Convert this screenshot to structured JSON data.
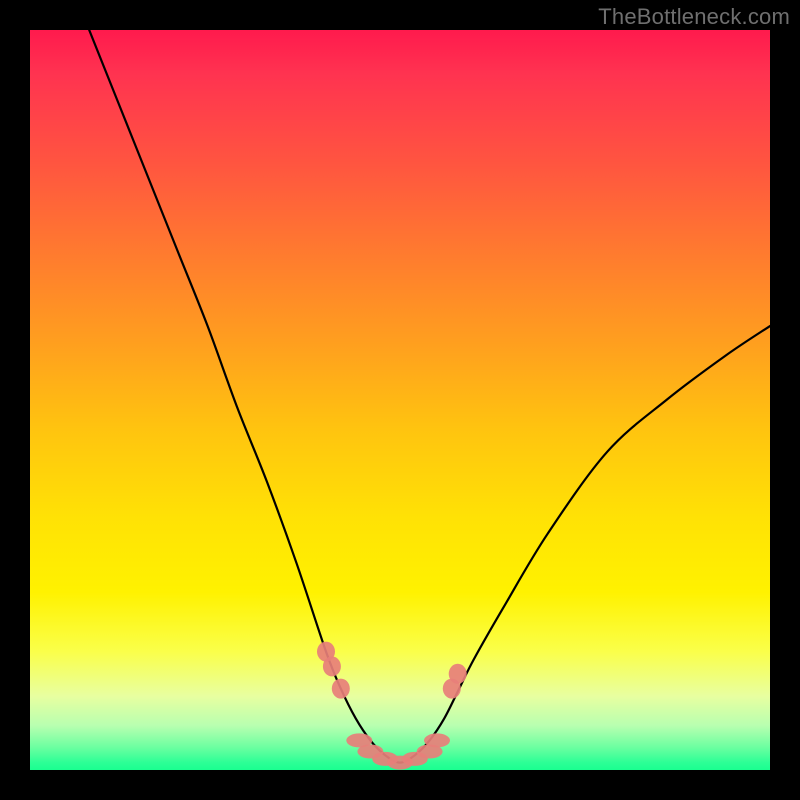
{
  "watermark": "TheBottleneck.com",
  "chart_data": {
    "type": "line",
    "title": "",
    "xlabel": "",
    "ylabel": "",
    "xlim": [
      0,
      100
    ],
    "ylim": [
      0,
      100
    ],
    "legend": false,
    "grid": false,
    "notes": "V-shaped bottleneck curve on a red→yellow→green vertical heat gradient. Single black curve dips from ~100% at x≈8 down to ~0% around x≈45–55, then rises to ~60% at x≈100. Salmon-pink highlight markers cluster near the valley floor and just above it on both flanks.",
    "series": [
      {
        "name": "bottleneck-curve",
        "color": "#000000",
        "x": [
          8,
          12,
          16,
          20,
          24,
          28,
          32,
          36,
          40,
          42,
          44,
          46,
          48,
          50,
          52,
          54,
          56,
          58,
          60,
          64,
          70,
          78,
          86,
          94,
          100
        ],
        "values": [
          100,
          90,
          80,
          70,
          60,
          49,
          39,
          28,
          16,
          11,
          7,
          4,
          2,
          1,
          2,
          4,
          7,
          11,
          15,
          22,
          32,
          43,
          50,
          56,
          60
        ]
      }
    ],
    "highlight_points": {
      "name": "valley-markers",
      "color": "#e77f7a",
      "points": [
        {
          "x": 40.0,
          "y": 16
        },
        {
          "x": 40.8,
          "y": 14
        },
        {
          "x": 42.0,
          "y": 11
        },
        {
          "x": 44.5,
          "y": 4
        },
        {
          "x": 46.0,
          "y": 2.5
        },
        {
          "x": 48.0,
          "y": 1.5
        },
        {
          "x": 50.0,
          "y": 1
        },
        {
          "x": 52.0,
          "y": 1.5
        },
        {
          "x": 54.0,
          "y": 2.5
        },
        {
          "x": 55.0,
          "y": 4
        },
        {
          "x": 57.0,
          "y": 11
        },
        {
          "x": 57.8,
          "y": 13
        }
      ]
    }
  }
}
